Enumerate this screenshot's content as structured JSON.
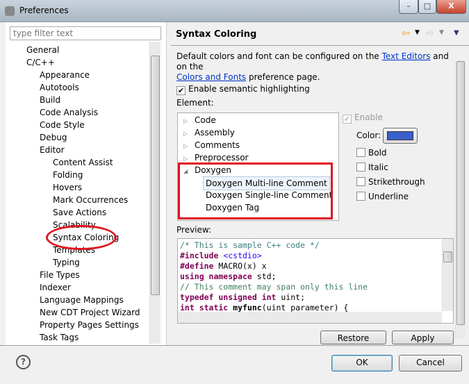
{
  "window": {
    "title": "Preferences",
    "minimize": "–",
    "maximize": "□",
    "close": "X"
  },
  "filter": {
    "placeholder": "type filter text"
  },
  "tree": [
    {
      "label": "General",
      "level": 0
    },
    {
      "label": "C/C++",
      "level": 0
    },
    {
      "label": "Appearance",
      "level": 1
    },
    {
      "label": "Autotools",
      "level": 1
    },
    {
      "label": "Build",
      "level": 1
    },
    {
      "label": "Code Analysis",
      "level": 1
    },
    {
      "label": "Code Style",
      "level": 1
    },
    {
      "label": "Debug",
      "level": 1
    },
    {
      "label": "Editor",
      "level": 1
    },
    {
      "label": "Content Assist",
      "level": 2
    },
    {
      "label": "Folding",
      "level": 2
    },
    {
      "label": "Hovers",
      "level": 2
    },
    {
      "label": "Mark Occurrences",
      "level": 2
    },
    {
      "label": "Save Actions",
      "level": 2
    },
    {
      "label": "Scalability",
      "level": 2
    },
    {
      "label": "Syntax Coloring",
      "level": 2
    },
    {
      "label": "Templates",
      "level": 2
    },
    {
      "label": "Typing",
      "level": 2
    },
    {
      "label": "File Types",
      "level": 1
    },
    {
      "label": "Indexer",
      "level": 1
    },
    {
      "label": "Language Mappings",
      "level": 1
    },
    {
      "label": "New CDT Project Wizard",
      "level": 1
    },
    {
      "label": "Property Pages Settings",
      "level": 1
    },
    {
      "label": "Task Tags",
      "level": 1
    }
  ],
  "page": {
    "title": "Syntax Coloring",
    "desc_1": "Default colors and font can be configured on the ",
    "link_text_editors": "Text Editors",
    "desc_2": " and on the",
    "link_colors_fonts": "Colors and Fonts",
    "desc_3": " preference page.",
    "semantic_label": "Enable semantic highlighting",
    "element_label": "Element:",
    "elements": [
      {
        "label": "Code",
        "expanded": false
      },
      {
        "label": "Assembly",
        "expanded": false
      },
      {
        "label": "Comments",
        "expanded": false
      },
      {
        "label": "Preprocessor",
        "expanded": false
      },
      {
        "label": "Doxygen",
        "expanded": true
      }
    ],
    "doxygen_children": [
      "Doxygen Multi-line Comment",
      "Doxygen Single-line Comment",
      "Doxygen Tag"
    ],
    "enable_label": "Enable",
    "color_label": "Color:",
    "color_value": "#3a5fcd",
    "bold": "Bold",
    "italic": "Italic",
    "strike": "Strikethrough",
    "underline": "Underline",
    "preview_label": "Preview:",
    "restore": "Restore Defaults",
    "apply": "Apply"
  },
  "preview_lines": [
    [
      {
        "t": "/* This is sample C++ code */",
        "c": "#3f7f7f"
      }
    ],
    [
      {
        "t": "#include ",
        "c": "#7f0055",
        "b": 1
      },
      {
        "t": "<cstdio>",
        "c": "#2a00ff"
      }
    ],
    [
      {
        "t": "#define ",
        "c": "#7f0055",
        "b": 1
      },
      {
        "t": "MACRO(x) x",
        "c": "#000"
      }
    ],
    [
      {
        "t": "using namespace ",
        "c": "#7f0055",
        "b": 1
      },
      {
        "t": "std;",
        "c": "#000"
      }
    ],
    [
      {
        "t": "// This comment may span only this line",
        "c": "#3f7f5f"
      }
    ],
    [
      {
        "t": "typedef unsigned int ",
        "c": "#7f0055",
        "b": 1
      },
      {
        "t": "uint;",
        "c": "#000"
      }
    ],
    [
      {
        "t": "int static ",
        "c": "#7f0055",
        "b": 1
      },
      {
        "t": "myfunc",
        "c": "#000",
        "b": 1
      },
      {
        "t": "(uint parameter) {",
        "c": "#000"
      }
    ]
  ],
  "footer": {
    "help": "?",
    "ok": "OK",
    "cancel": "Cancel"
  },
  "annotation_color": "#e0141e"
}
